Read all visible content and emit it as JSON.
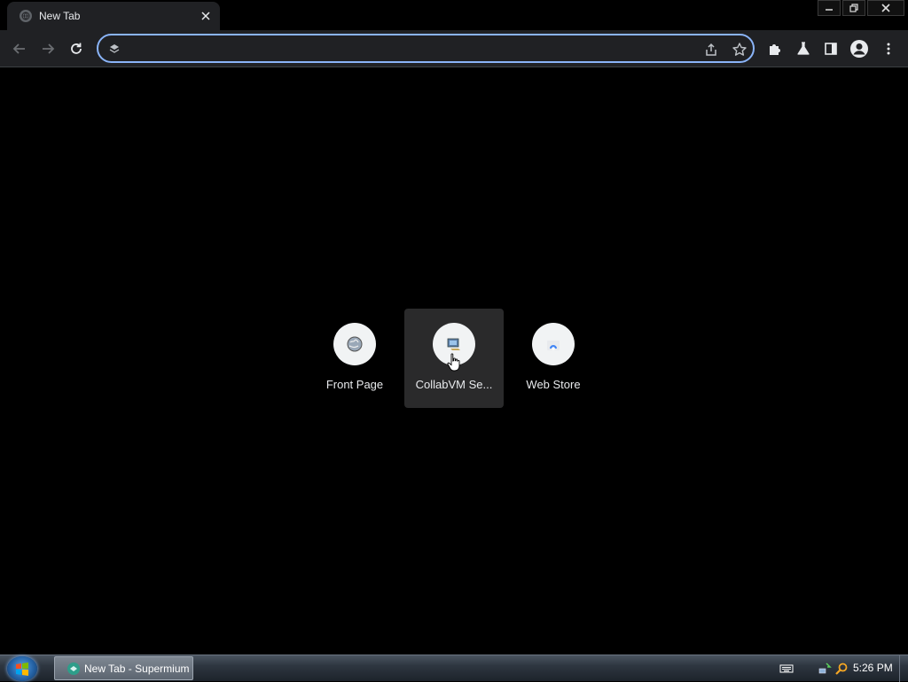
{
  "browser": {
    "tab": {
      "title": "New Tab"
    },
    "omnibox": {
      "value": "",
      "placeholder": ""
    }
  },
  "shortcuts": [
    {
      "label": "Front Page",
      "icon": "globe-icon"
    },
    {
      "label": "CollabVM Se...",
      "icon": "computer-icon"
    },
    {
      "label": "Web Store",
      "icon": "web-store-icon"
    }
  ],
  "taskbar": {
    "item_label": "New Tab - Supermium",
    "clock": "5:26 PM"
  },
  "colors": {
    "accent": "#8ab4f8",
    "toolbar": "#202124",
    "background": "#000000"
  }
}
